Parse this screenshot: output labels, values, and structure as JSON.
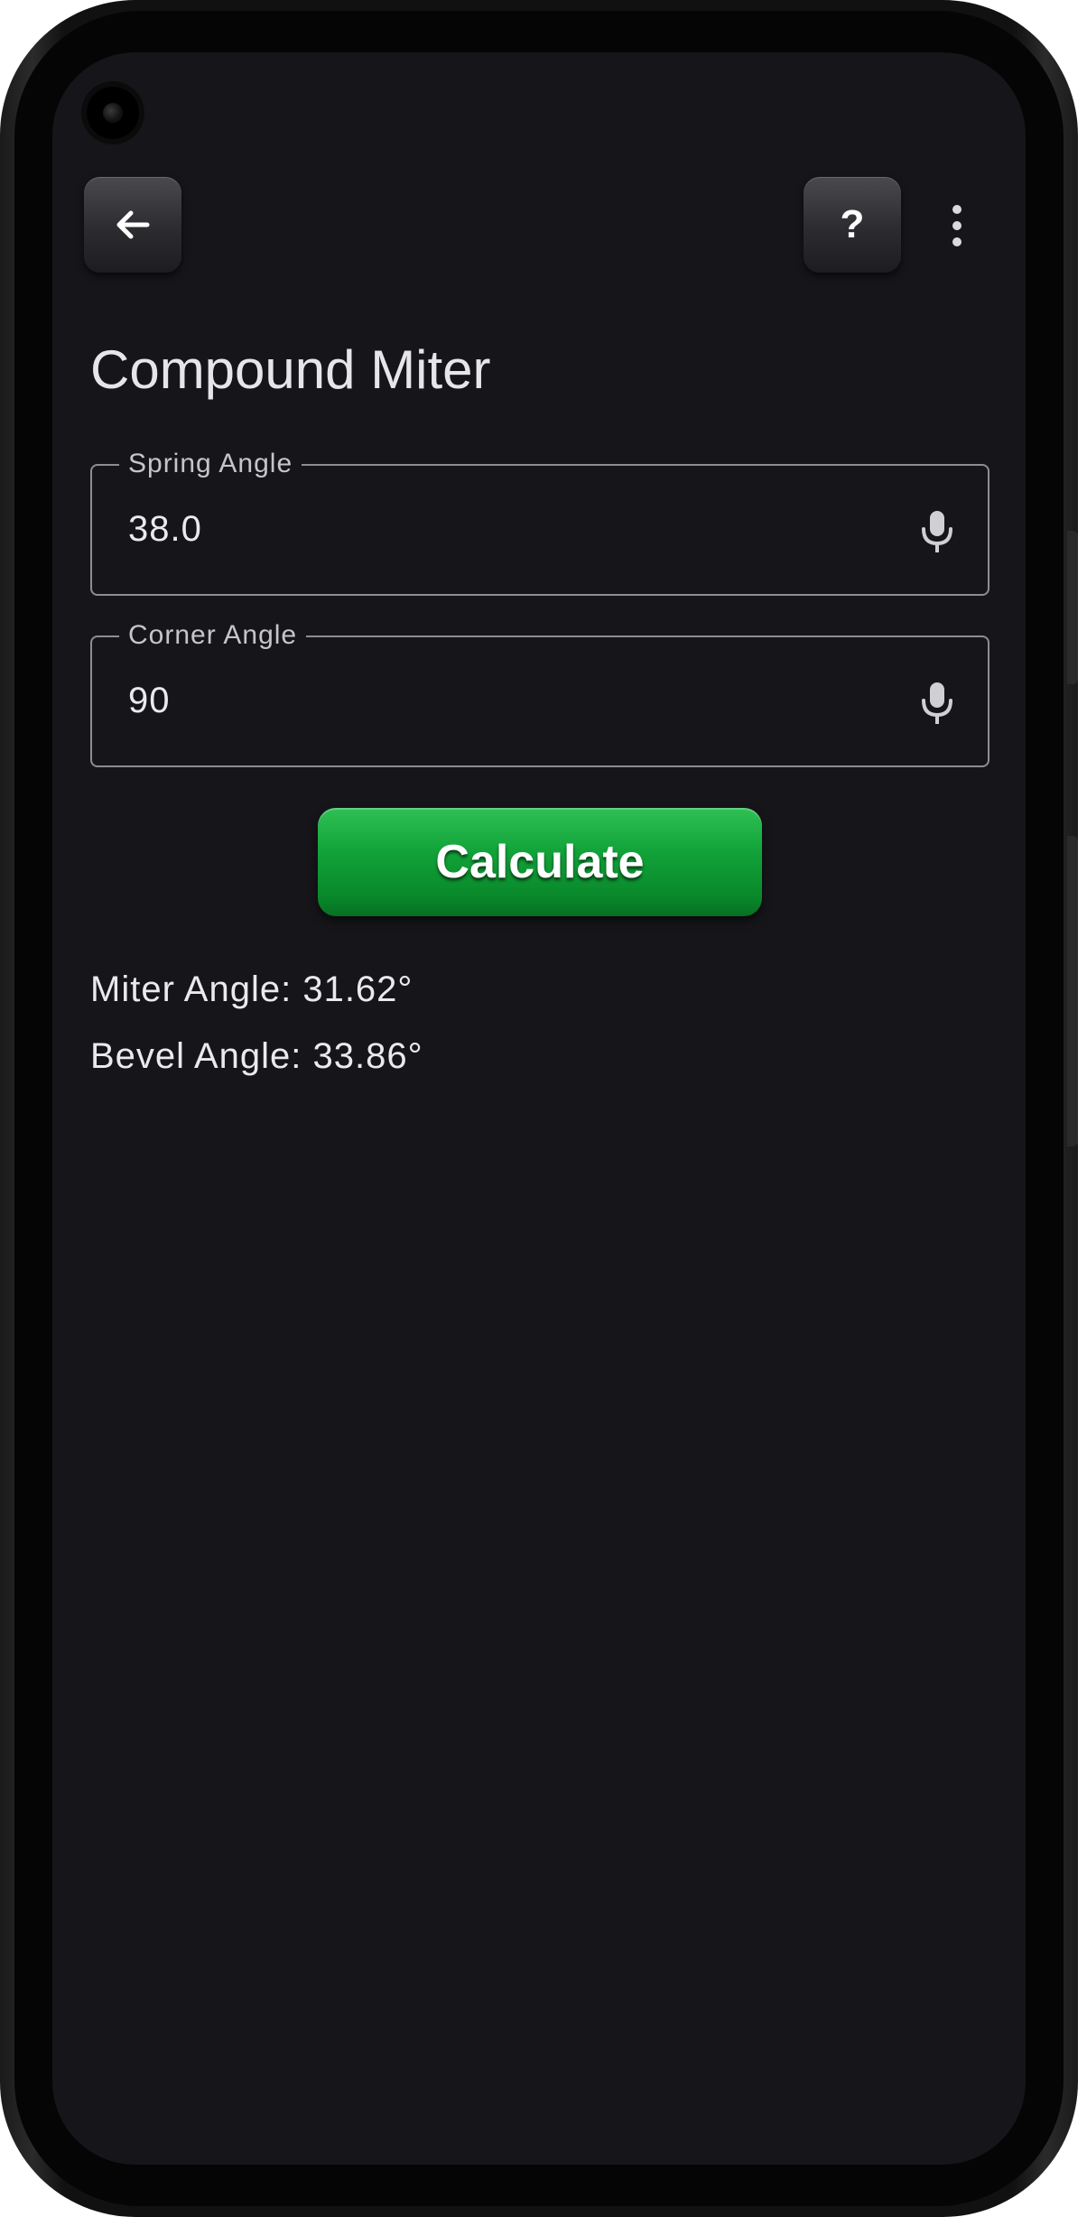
{
  "header": {
    "back_icon": "arrow-left-icon",
    "help_label": "?",
    "more_icon": "more-vertical-icon"
  },
  "page": {
    "title": "Compound Miter"
  },
  "fields": {
    "spring_angle": {
      "label": "Spring Angle",
      "value": "38.0",
      "icon": "microphone-icon"
    },
    "corner_angle": {
      "label": "Corner Angle",
      "value": "90",
      "icon": "microphone-icon"
    }
  },
  "actions": {
    "calculate_label": "Calculate"
  },
  "results": {
    "miter": "Miter Angle: 31.62°",
    "bevel": "Bevel Angle: 33.86°"
  },
  "colors": {
    "background": "#16161a",
    "accent_green": "#12a33a",
    "text": "#e9e9ee",
    "field_border": "#8d8d92"
  }
}
